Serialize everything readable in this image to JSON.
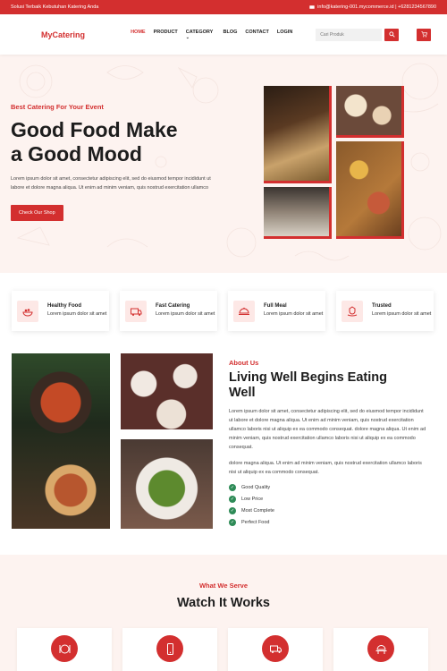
{
  "topbar": {
    "tagline": "Solusi Terbaik Kebutuhan Katering Anda",
    "contact": "info@katering-001.mycommerce.id | +6281234567890"
  },
  "nav": {
    "logo": "MyCatering",
    "items": [
      {
        "label": "HOME",
        "active": true
      },
      {
        "label": "PRODUCT"
      },
      {
        "label": "CATEGORY"
      },
      {
        "label": "BLOG"
      },
      {
        "label": "CONTACT"
      },
      {
        "label": "LOGIN"
      }
    ],
    "search_placeholder": "Cari Produk"
  },
  "hero": {
    "subtitle": "Best Catering For Your Event",
    "title_line1": "Good Food Make",
    "title_line2": "a Good Mood",
    "description": "Lorem ipsum dolor sit amet, consectetur adipiscing elit, sed do eiusmod tempor incididunt ut labore et dolore magna aliqua. Ut enim ad minim veniam, quis nostrud exercitation ullamco",
    "button": "Check Our Shop"
  },
  "features": [
    {
      "icon": "food-plate-icon",
      "title": "Healthy Food",
      "desc": "Lorem ipsum dolor sit amet"
    },
    {
      "icon": "catering-truck-icon",
      "title": "Fast Catering",
      "desc": "Lorem ipsum dolor sit amet"
    },
    {
      "icon": "cloche-icon",
      "title": "Full Meal",
      "desc": "Lorem ipsum dolor sit amet"
    },
    {
      "icon": "hand-trust-icon",
      "title": "Trusted",
      "desc": "Lorem ipsum dolor sit amet"
    }
  ],
  "about": {
    "subtitle": "About Us",
    "title_line1": "Living Well Begins Eating",
    "title_line2": "Well",
    "para1": "Lorem ipsum dolor sit amet, consectetur adipiscing elit, sed do eiusmod tempor incididunt ut labore et dolore magna aliqua. Ut enim ad minim veniam, quis nostrud exercitation ullamco laboris nisi ut aliquip ex ea commodo consequat. dolore magna aliqua. Ut enim ad minim veniam, quis nostrud exercitation ullamco laboris nisi ut aliquip ex ea commodo consequat.",
    "para2": "dolore magna aliqua. Ut enim ad minim veniam, quis nostrud exercitation ullamco laboris nisi ut aliquip ex ea commodo consequat.",
    "checks": [
      "Good Quality",
      "Low Price",
      "Most Complete",
      "Perfect Food"
    ]
  },
  "serve": {
    "subtitle": "What We Serve",
    "title": "Watch It Works",
    "steps": [
      {
        "icon": "restaurant-icon"
      },
      {
        "icon": "mobile-order-icon"
      },
      {
        "icon": "delivery-truck-icon"
      },
      {
        "icon": "serving-table-icon"
      }
    ]
  },
  "colors": {
    "accent": "#d32f2f",
    "hero_bg": "#fdf3f0",
    "check": "#2e8b57"
  }
}
